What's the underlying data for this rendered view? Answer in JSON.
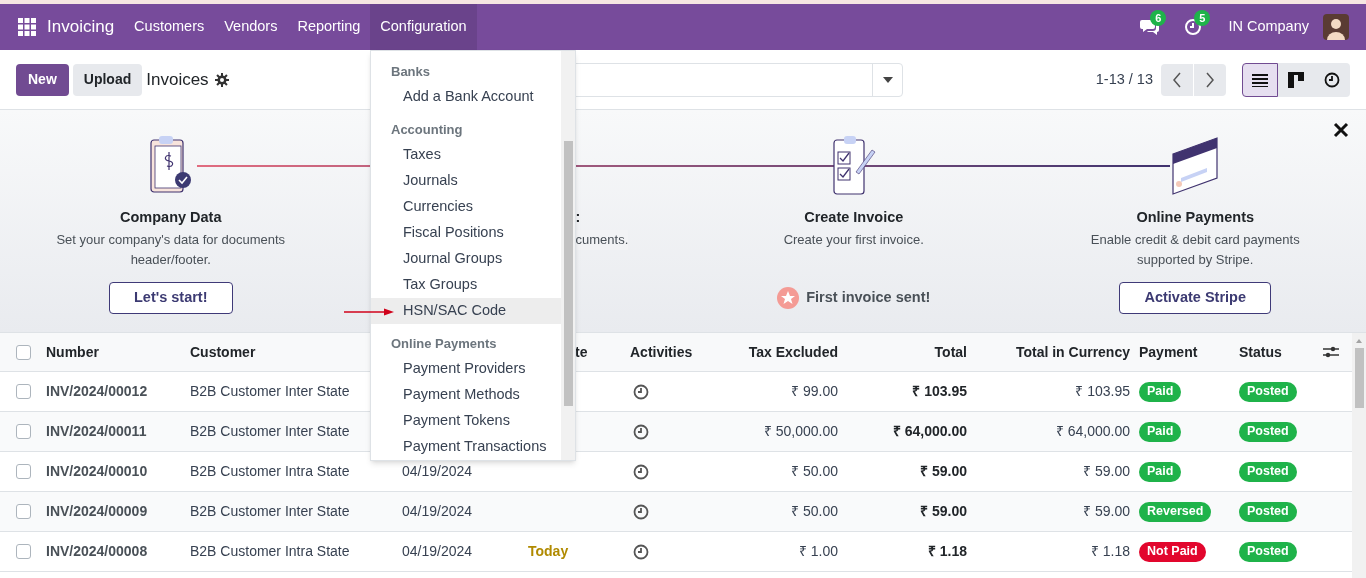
{
  "top_bar": {
    "app_name": "Invoicing",
    "menu": [
      {
        "label": "Customers",
        "selected": false
      },
      {
        "label": "Vendors",
        "selected": false
      },
      {
        "label": "Reporting",
        "selected": false
      },
      {
        "label": "Configuration",
        "selected": true
      }
    ],
    "messages_badge": "6",
    "activities_badge": "5",
    "company": "IN Company"
  },
  "control_panel": {
    "new_button": "New",
    "upload_button": "Upload",
    "title": "Invoices",
    "pager": "1-13 / 13",
    "views": [
      {
        "kind": "list",
        "selected": true
      },
      {
        "kind": "kanban",
        "selected": false
      },
      {
        "kind": "activity",
        "selected": false
      }
    ]
  },
  "onboarding": {
    "steps": [
      {
        "kind": "button",
        "title": "Company Data",
        "description": "Set your company's data for documents header/footer.",
        "action": "Let's start!"
      },
      {
        "kind": "covered",
        "title": ":",
        "description": "cuments."
      },
      {
        "kind": "done",
        "title": "Create Invoice",
        "description": "Create your first invoice.",
        "action": "First invoice sent!"
      },
      {
        "kind": "button",
        "title": "Online Payments",
        "description": "Enable credit & debit card payments supported by Stripe.",
        "action": "Activate Stripe"
      }
    ]
  },
  "dropdown": {
    "sections": [
      {
        "title": "Banks",
        "items": [
          {
            "label": "Add a Bank Account",
            "selected": false
          }
        ]
      },
      {
        "title": "Accounting",
        "items": [
          {
            "label": "Taxes",
            "selected": false
          },
          {
            "label": "Journals",
            "selected": false
          },
          {
            "label": "Currencies",
            "selected": false
          },
          {
            "label": "Fiscal Positions",
            "selected": false
          },
          {
            "label": "Journal Groups",
            "selected": false
          },
          {
            "label": "Tax Groups",
            "selected": false
          },
          {
            "label": "HSN/SAC Code",
            "selected": true
          }
        ]
      },
      {
        "title": "Online Payments",
        "items": [
          {
            "label": "Payment Providers",
            "selected": false
          },
          {
            "label": "Payment Methods",
            "selected": false
          },
          {
            "label": "Payment Tokens",
            "selected": false
          },
          {
            "label": "Payment Transactions",
            "selected": false
          }
        ]
      }
    ]
  },
  "table": {
    "select_all_checked": false,
    "header": {
      "number": "Number",
      "customer": "Customer",
      "column_5": "te",
      "activities": "Activities",
      "tax_excluded": "Tax Excluded",
      "total": "Total",
      "total_in_currency": "Total in Currency",
      "payment": "Payment",
      "status": "Status"
    },
    "rows": [
      {
        "checked": false,
        "number": "INV/2024/00012",
        "customer": "B2B Customer Inter State",
        "tax_excluded": "₹ 99.00",
        "total": "₹ 103.95",
        "total_in_currency": "₹ 103.95",
        "payment": {
          "label": "Paid",
          "color": "#1fb34a"
        },
        "status": {
          "label": "Posted",
          "color": "#1fb34a"
        }
      },
      {
        "checked": false,
        "number": "INV/2024/00011",
        "customer": "B2B Customer Inter State",
        "tax_excluded": "₹ 50,000.00",
        "total": "₹ 64,000.00",
        "total_in_currency": "₹ 64,000.00",
        "payment": {
          "label": "Paid",
          "color": "#1fb34a"
        },
        "status": {
          "label": "Posted",
          "color": "#1fb34a"
        }
      },
      {
        "checked": false,
        "number": "INV/2024/00010",
        "customer": "B2B Customer Intra State",
        "invoice_date": "04/19/2024",
        "tax_excluded": "₹ 50.00",
        "total": "₹ 59.00",
        "total_in_currency": "₹ 59.00",
        "payment": {
          "label": "Paid",
          "color": "#1fb34a"
        },
        "status": {
          "label": "Posted",
          "color": "#1fb34a"
        }
      },
      {
        "checked": false,
        "number": "INV/2024/00009",
        "customer": "B2B Customer Inter State",
        "invoice_date": "04/19/2024",
        "tax_excluded": "₹ 50.00",
        "total": "₹ 59.00",
        "total_in_currency": "₹ 59.00",
        "payment": {
          "label": "Reversed",
          "color": "#1fb34a"
        },
        "status": {
          "label": "Posted",
          "color": "#1fb34a"
        }
      },
      {
        "checked": false,
        "number": "INV/2024/00008",
        "customer": "B2B Customer Intra State",
        "invoice_date": "04/19/2024",
        "due_date": "Today",
        "tax_excluded": "₹ 1.00",
        "total": "₹ 1.18",
        "total_in_currency": "₹ 1.18",
        "payment": {
          "label": "Not Paid",
          "color": "#e2062d"
        },
        "status": {
          "label": "Posted",
          "color": "#1fb34a"
        }
      }
    ]
  }
}
